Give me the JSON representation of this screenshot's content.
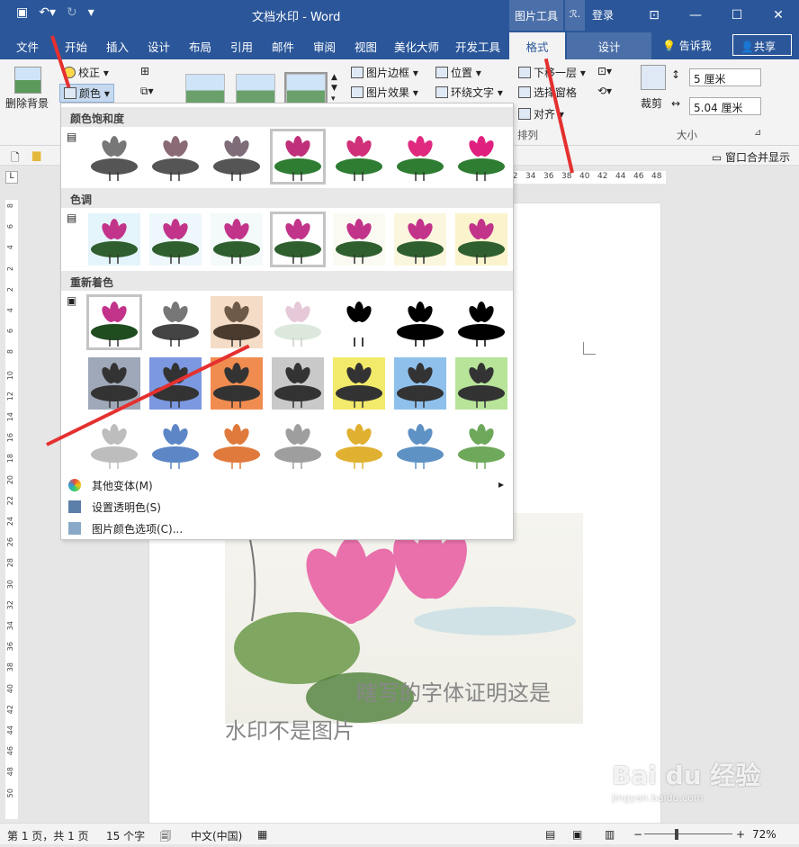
{
  "window": {
    "title": "文档水印 - Word",
    "context_tab_group": "图片工具",
    "context_small": "ℛ.",
    "login": "登录"
  },
  "tabs": [
    "文件",
    "开始",
    "插入",
    "设计",
    "布局",
    "引用",
    "邮件",
    "审阅",
    "视图",
    "美化大师",
    "开发工具"
  ],
  "active_tab": "格式",
  "design_tab": "设计",
  "tell_me": "告诉我",
  "share": "共享",
  "ribbon": {
    "remove_bg": "删除背景",
    "correct": "校正",
    "color": "颜色",
    "pic_border": "图片边框",
    "pic_effect": "图片效果",
    "position": "位置",
    "wrap_text": "环绕文字",
    "send_backward": "下移一层",
    "selection_pane": "选择窗格",
    "align": "对齐",
    "arrange": "排列",
    "crop": "裁剪",
    "height": "5 厘米",
    "width": "5.04 厘米",
    "size": "大小",
    "window_merge": "窗口合并显示"
  },
  "ruler_ticks": [
    "32",
    "34",
    "36",
    "38",
    "40",
    "42",
    "44",
    "46",
    "48"
  ],
  "vruler_ticks": [
    "8",
    "6",
    "4",
    "2",
    "2",
    "4",
    "6",
    "8",
    "10",
    "12",
    "14",
    "16",
    "18",
    "20",
    "22",
    "24",
    "26",
    "28",
    "30",
    "32",
    "34",
    "36",
    "38",
    "40",
    "42",
    "44",
    "46",
    "48",
    "50"
  ],
  "dropdown": {
    "saturation_header": "颜色饱和度",
    "tone_header": "色调",
    "recolor_header": "重新着色",
    "more_variations": "其他变体(M)",
    "set_transparent": "设置透明色(S)",
    "color_options": "图片颜色选项(C)..."
  },
  "swatches": {
    "saturation": [
      "#777777",
      "#8a6a75",
      "#7e6c78",
      "#c0307a",
      "#d0307a",
      "#e02a80",
      "#e0207e"
    ],
    "tone_bg": [
      "#e4f4fb",
      "#eef7fb",
      "#f4f9fa",
      "#ffffff",
      "#fbfaf2",
      "#fbf6de",
      "#fbf3cc"
    ],
    "recolor_row1_bg": [
      "#ffffff",
      "#ffffff",
      "#f4dcc7",
      "#ffffff",
      "#ffffff",
      "#ffffff",
      "#ffffff"
    ],
    "recolor_row2_bg": [
      "#9fa8b8",
      "#7b98e0",
      "#f08c50",
      "#c9c9c9",
      "#f2ea6a",
      "#8fc0ec",
      "#b8e49a"
    ],
    "recolor_row3_fg": [
      "#bdbdbd",
      "#5c86c6",
      "#e07a3c",
      "#9e9e9e",
      "#e0b030",
      "#5f92c4",
      "#6ea85a"
    ]
  },
  "document": {
    "line1": "瞎写的字体证明这是",
    "line2": "水印不是图片"
  },
  "status": {
    "page": "第 1 页，共 1 页",
    "words": "15 个字",
    "lang": "中文(中国)",
    "zoom": "72%"
  },
  "watermark": "Bai du 经验",
  "watermark_sub": "jingyan.baidu.com"
}
